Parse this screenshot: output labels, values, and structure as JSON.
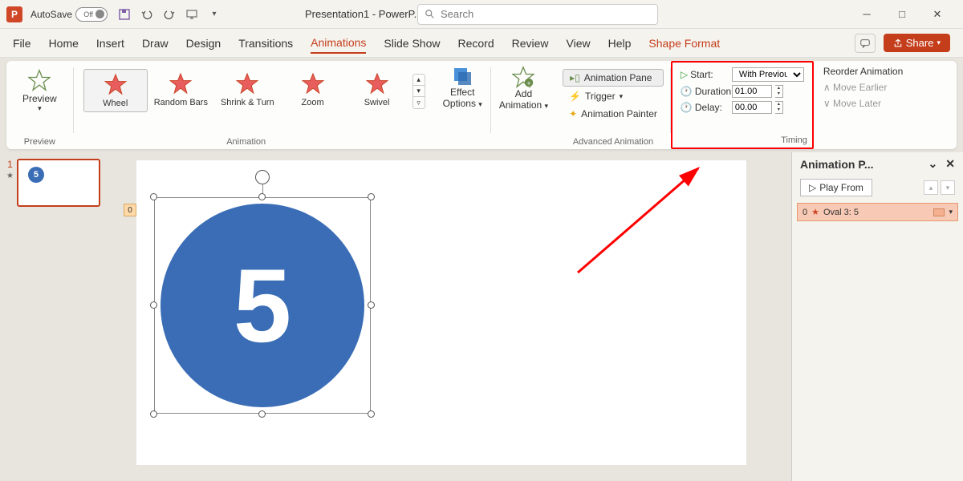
{
  "titlebar": {
    "autosave_label": "AutoSave",
    "autosave_state": "Off",
    "doc_name": "Presentation1 - PowerP..."
  },
  "search": {
    "placeholder": "Search"
  },
  "tabs": {
    "file": "File",
    "home": "Home",
    "insert": "Insert",
    "draw": "Draw",
    "design": "Design",
    "transitions": "Transitions",
    "animations": "Animations",
    "slideshow": "Slide Show",
    "record": "Record",
    "review": "Review",
    "view": "View",
    "help": "Help",
    "shape_format": "Shape Format",
    "share": "Share"
  },
  "ribbon": {
    "preview": {
      "label": "Preview",
      "group": "Preview"
    },
    "animations": {
      "items": [
        "Wheel",
        "Random Bars",
        "Shrink & Turn",
        "Zoom",
        "Swivel"
      ],
      "group": "Animation"
    },
    "effect_options": {
      "l1": "Effect",
      "l2": "Options"
    },
    "add_animation": {
      "l1": "Add",
      "l2": "Animation"
    },
    "advanced": {
      "pane": "Animation Pane",
      "trigger": "Trigger",
      "painter": "Animation Painter",
      "group": "Advanced Animation"
    },
    "timing": {
      "start_label": "Start:",
      "start_value": "With Previous",
      "duration_label": "Duration:",
      "duration_value": "01.00",
      "delay_label": "Delay:",
      "delay_value": "00.00",
      "group": "Timing"
    },
    "reorder": {
      "title": "Reorder Animation",
      "earlier": "Move Earlier",
      "later": "Move Later"
    }
  },
  "thumbnails": {
    "slide1_num": "1",
    "circle_text": "5"
  },
  "slide": {
    "anim_tag": "0",
    "circle_text": "5"
  },
  "anim_pane": {
    "title": "Animation P...",
    "play": "Play From",
    "item_index": "0",
    "item_name": "Oval 3: 5"
  }
}
